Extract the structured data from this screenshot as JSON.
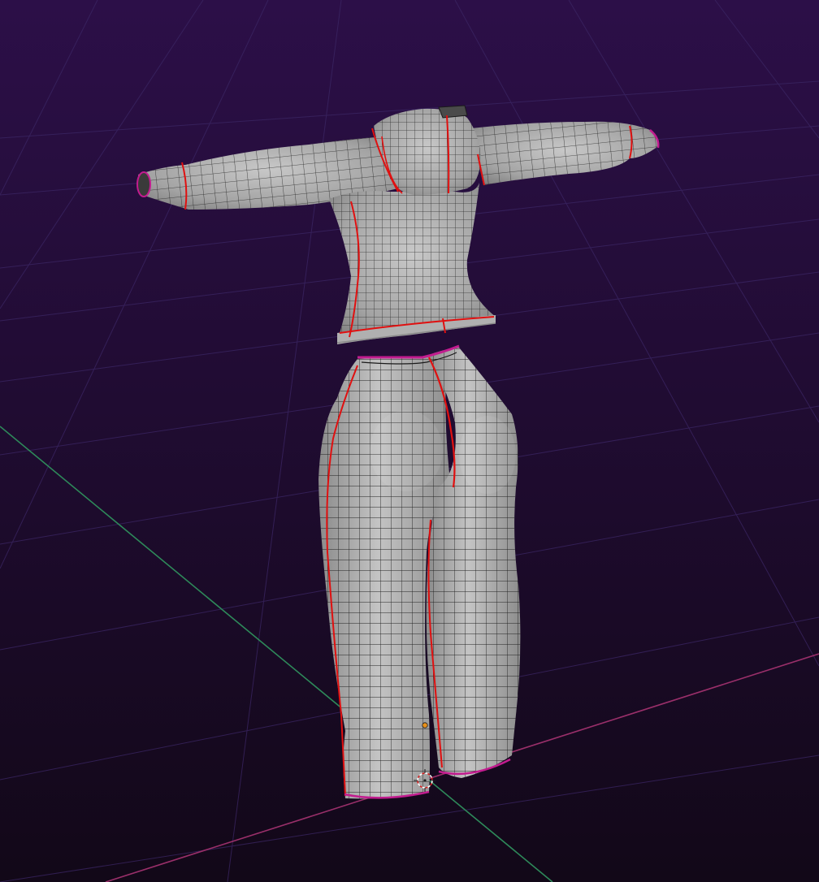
{
  "app": {
    "name": "",
    "mode": "edit"
  },
  "viewport": {
    "background_top": "#2c0f48",
    "background_bottom": "#120818",
    "grid_color": "#3a2660",
    "axis_x_color": "#9a2f6a",
    "axis_y_color": "#2e8a5a"
  },
  "mesh": {
    "object_type": "clothing",
    "pieces": [
      "top",
      "pants"
    ],
    "surface_color": "#a9a9a9",
    "wire_color": "#1a1a1a",
    "seam_color": "#e01010",
    "boundary_color": "#c21c8f"
  },
  "origin": {
    "color": "#e8901a"
  },
  "cursor_3d": {
    "ring_color_a": "#ffffff",
    "ring_color_b": "#d62020"
  }
}
